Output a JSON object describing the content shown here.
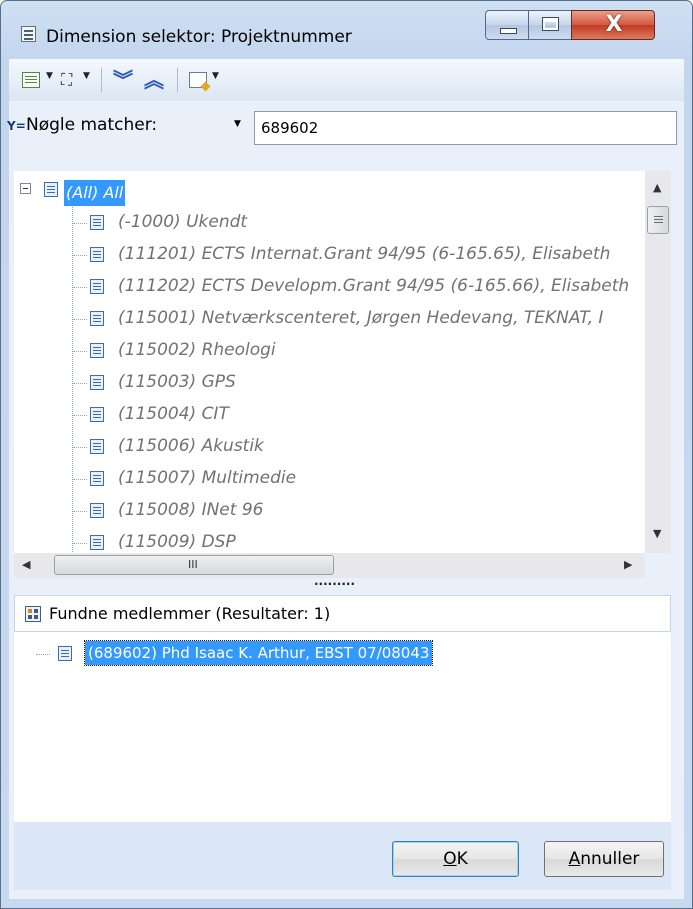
{
  "window": {
    "title": "Dimension selektor: Projektnummer",
    "close_glyph": "X"
  },
  "filter": {
    "mode_label": "Nøgle matcher:",
    "value": "689602"
  },
  "tree": {
    "root": "(All) All",
    "items": [
      "(-1000) Ukendt",
      "(111201) ECTS Internat.Grant 94/95 (6-165.65), Elisabeth",
      "(111202) ECTS Developm.Grant 94/95 (6-165.66), Elisabeth",
      "(115001) Netværkscenteret, Jørgen Hedevang, TEKNAT, I",
      "(115002) Rheologi",
      "(115003) GPS",
      "(115004) CIT",
      "(115006) Akustik",
      "(115007) Multimedie",
      "(115008) INet 96",
      "(115009) DSP"
    ]
  },
  "scroll": {
    "h_grip": "III",
    "splitter": "........."
  },
  "results": {
    "title": "Fundne medlemmer (Resultater: 1)",
    "items": [
      "(689602) Phd Isaac K. Arthur, EBST 07/08043"
    ]
  },
  "buttons": {
    "ok_mnemonic": "O",
    "ok_rest": "K",
    "cancel_mnemonic": "A",
    "cancel_rest": "nnuller"
  },
  "colors": {
    "selection": "#3399ff",
    "window_frame": "#c3d6ee",
    "close_button": "#c23a22"
  }
}
